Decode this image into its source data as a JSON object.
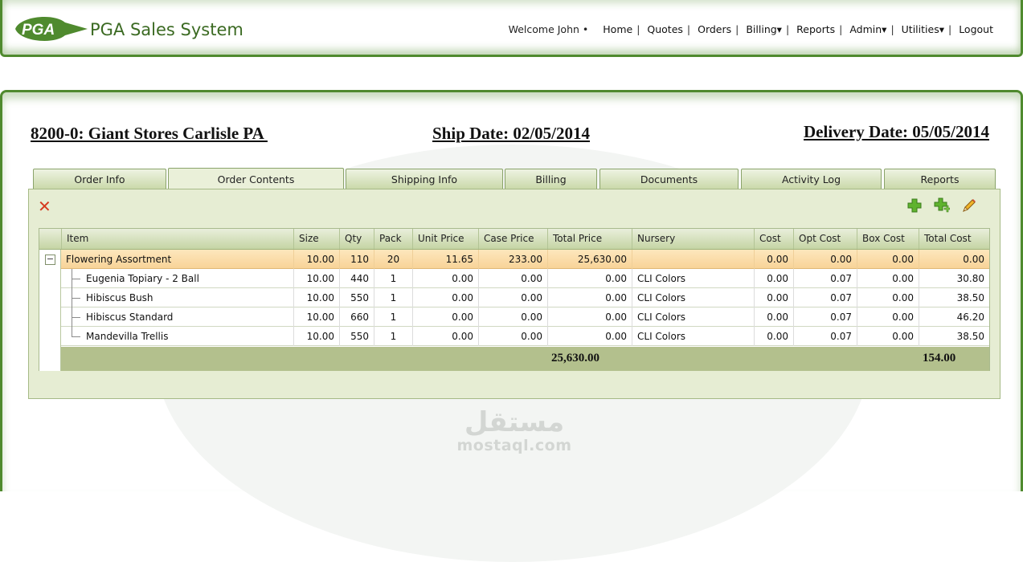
{
  "header": {
    "logo_text": "PGA",
    "app_title": "PGA Sales System",
    "welcome": "Welcome John •",
    "nav": [
      "Home",
      "Quotes",
      "Orders",
      "Billing▾",
      "Reports",
      "Admin▾",
      "Utilities▾",
      "Logout"
    ]
  },
  "order": {
    "customer": "8200-0: Giant Stores Carlisle PA ",
    "ship_date": "Ship Date: 02/05/2014",
    "delivery_date": "Delivery Date: 05/05/2014"
  },
  "tabs": [
    {
      "label": "Order Info",
      "active": false
    },
    {
      "label": "Order Contents",
      "active": true
    },
    {
      "label": "Shipping Info",
      "active": false
    },
    {
      "label": "Billing",
      "active": false
    },
    {
      "label": "Documents",
      "active": false
    },
    {
      "label": "Activity Log",
      "active": false
    },
    {
      "label": "Reports",
      "active": false
    }
  ],
  "toolbar": {
    "delete_icon": "x-icon",
    "add_icon": "plus-icon",
    "add_child_icon": "plus-sub-icon",
    "edit_icon": "pencil-icon"
  },
  "grid": {
    "columns": [
      "Item",
      "Size",
      "Qty",
      "Pack",
      "Unit Price",
      "Case Price",
      "Total Price",
      "Nursery",
      "Cost",
      "Opt Cost",
      "Box Cost",
      "Total Cost"
    ],
    "rows": [
      {
        "item": "Flowering Assortment",
        "size": "10.00",
        "qty": "110",
        "pack": "20",
        "unit_price": "11.65",
        "case_price": "233.00",
        "total_price": "25,630.00",
        "nursery": "",
        "cost": "0.00",
        "opt_cost": "0.00",
        "box_cost": "0.00",
        "total_cost": "0.00"
      },
      {
        "item": "Eugenia Topiary - 2 Ball",
        "size": "10.00",
        "qty": "440",
        "pack": "1",
        "unit_price": "0.00",
        "case_price": "0.00",
        "total_price": "0.00",
        "nursery": "CLI Colors",
        "cost": "0.00",
        "opt_cost": "0.07",
        "box_cost": "0.00",
        "total_cost": "30.80"
      },
      {
        "item": "Hibiscus Bush",
        "size": "10.00",
        "qty": "550",
        "pack": "1",
        "unit_price": "0.00",
        "case_price": "0.00",
        "total_price": "0.00",
        "nursery": "CLI Colors",
        "cost": "0.00",
        "opt_cost": "0.07",
        "box_cost": "0.00",
        "total_cost": "38.50"
      },
      {
        "item": "Hibiscus Standard",
        "size": "10.00",
        "qty": "660",
        "pack": "1",
        "unit_price": "0.00",
        "case_price": "0.00",
        "total_price": "0.00",
        "nursery": "CLI Colors",
        "cost": "0.00",
        "opt_cost": "0.07",
        "box_cost": "0.00",
        "total_cost": "46.20"
      },
      {
        "item": "Mandevilla Trellis",
        "size": "10.00",
        "qty": "550",
        "pack": "1",
        "unit_price": "0.00",
        "case_price": "0.00",
        "total_price": "0.00",
        "nursery": "CLI Colors",
        "cost": "0.00",
        "opt_cost": "0.07",
        "box_cost": "0.00",
        "total_cost": "38.50"
      }
    ],
    "totals": {
      "total_price": "25,630.00",
      "total_cost": "154.00"
    }
  },
  "watermark": {
    "arabic": "مستقل",
    "latin": "mostaql.com"
  },
  "colors": {
    "brand_green": "#4f8a2e",
    "tab_bg": "#c9d8a8",
    "panel_bg": "#e6edd3",
    "parent_row": "#f8d398",
    "footer_row": "#b3c08d"
  }
}
